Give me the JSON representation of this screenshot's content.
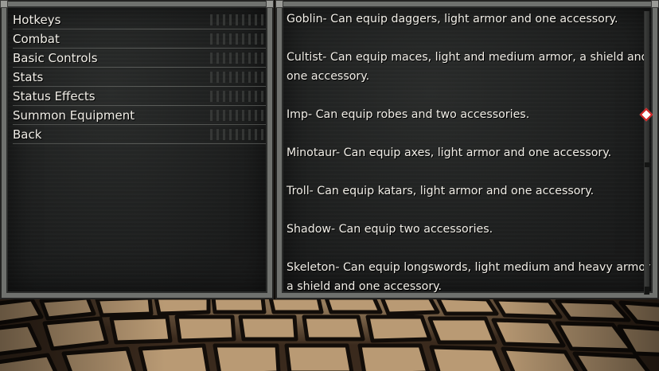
{
  "menu": {
    "items": [
      {
        "label": "Hotkeys"
      },
      {
        "label": "Combat"
      },
      {
        "label": "Basic Controls"
      },
      {
        "label": "Stats"
      },
      {
        "label": "Status Effects"
      },
      {
        "label": "Summon Equipment"
      },
      {
        "label": "Back"
      }
    ]
  },
  "info": {
    "lines": [
      "Goblin- Can equip daggers, light armor and one accessory.",
      "Cultist- Can equip maces, light and medium armor, a shield and",
      "one accessory.",
      "Imp- Can equip robes and two accessories.",
      "Minotaur- Can equip axes, light armor and one accessory.",
      "Troll- Can equip katars, light armor and one accessory.",
      "Shadow- Can equip two accessories.",
      "Skeleton- Can equip longswords, light medium and heavy armor",
      "a shield and one accessory."
    ]
  },
  "colors": {
    "text": "#f2efe8",
    "panel_border": "#6f716e",
    "panel_bg": "#1e1f1f",
    "cursor_fill": "#ffffff",
    "cursor_border": "#d02020"
  },
  "icons": {
    "cursor": "diamond-cursor-icon"
  }
}
